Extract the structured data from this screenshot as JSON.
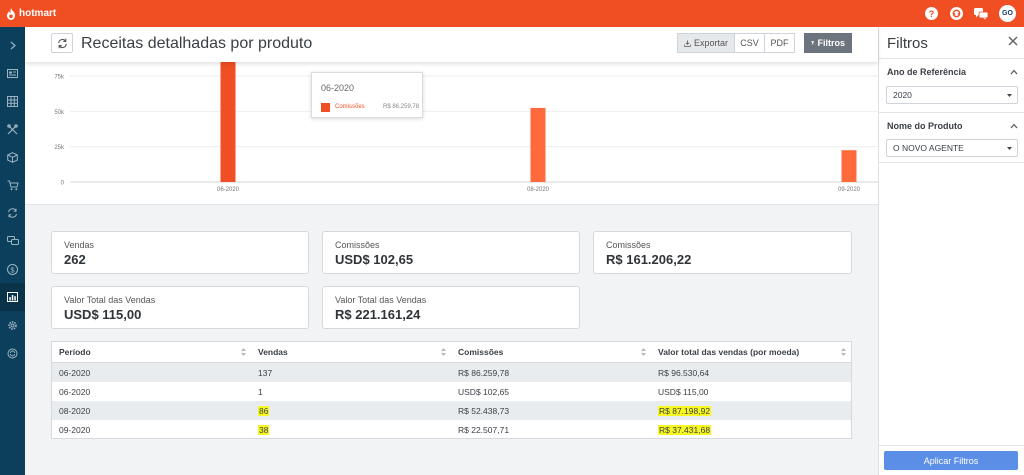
{
  "brand": {
    "name": "hotmart"
  },
  "topbar": {
    "avatar_text": "GO"
  },
  "header": {
    "title": "Receitas detalhadas por produto",
    "export_label": "Exportar",
    "csv_label": "CSV",
    "pdf_label": "PDF",
    "filters_label": "Filtros"
  },
  "chart_data": {
    "type": "bar",
    "categories": [
      "06-2020",
      "08-2020",
      "09-2020"
    ],
    "series": [
      {
        "name": "Comissões",
        "values": [
          86259.78,
          52438.73,
          22507.71
        ]
      }
    ],
    "y_ticks": [
      "0",
      "25k",
      "50k",
      "75k"
    ],
    "ylim": [
      0,
      92000
    ],
    "grid": true,
    "bar_color": "#f04e23"
  },
  "tooltip": {
    "title": "06-2020",
    "series_name": "Comissões",
    "value": "R$ 86.259,78"
  },
  "cards": [
    {
      "label": "Vendas",
      "value": "262"
    },
    {
      "label": "Comissões",
      "value": "USD$ 102,65"
    },
    {
      "label": "Comissões",
      "value": "R$ 161.206,22"
    },
    {
      "label": "Valor Total das Vendas",
      "value": "USD$ 115,00"
    },
    {
      "label": "Valor Total das Vendas",
      "value": "R$ 221.161,24"
    }
  ],
  "table": {
    "columns": [
      "Período",
      "Vendas",
      "Comissões",
      "Valor total das vendas (por moeda)"
    ],
    "rows": [
      [
        "06-2020",
        "137",
        "R$ 86.259,78",
        "R$ 96.530,64"
      ],
      [
        "06-2020",
        "1",
        "USD$ 102,65",
        "USD$ 115,00"
      ],
      [
        "08-2020",
        "86",
        "R$ 52.438,73",
        "R$ 87.198,92"
      ],
      [
        "09-2020",
        "38",
        "R$ 22.507,71",
        "R$ 37.431,68"
      ]
    ]
  },
  "panel": {
    "title": "Filtros",
    "year_label": "Ano de Referência",
    "year_value": "2020",
    "product_label": "Nome do Produto",
    "product_value": "O NOVO AGENTE",
    "apply_label": "Aplicar Filtros"
  },
  "colors": {
    "brand": "#f04e23",
    "nav": "#0c3f5c",
    "highlight": "#f7f722",
    "apply": "#5b8ee6"
  }
}
